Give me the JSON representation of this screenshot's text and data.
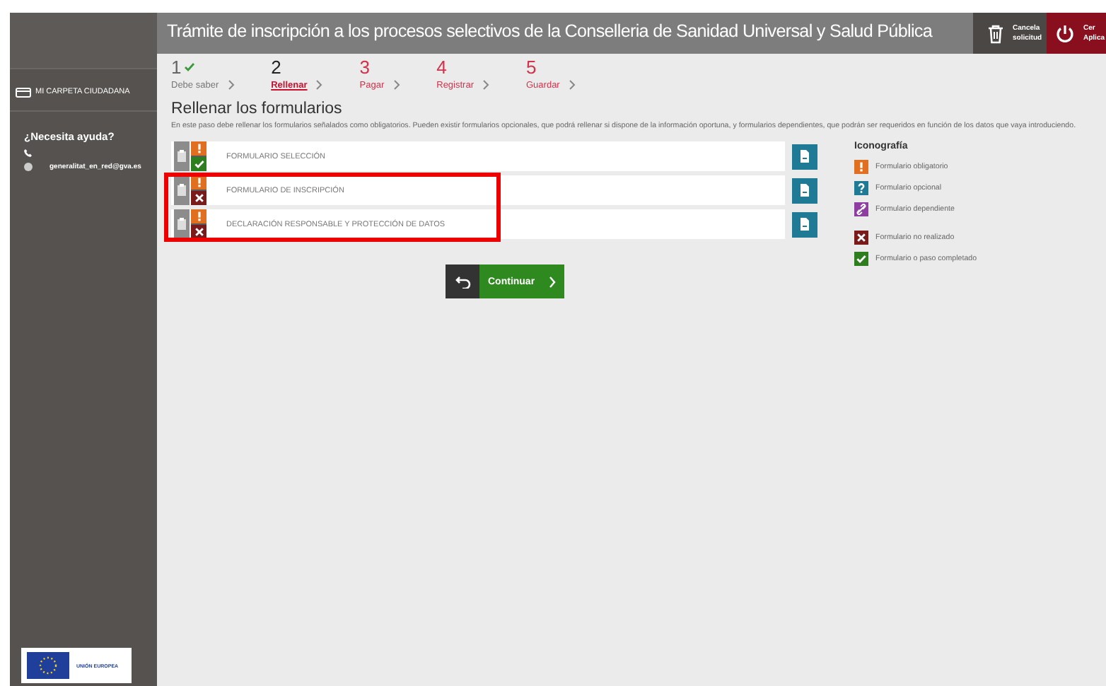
{
  "sidebar": {
    "folder_link": "MI CARPETA CIUDADANA",
    "help_title": "¿Necesita ayuda?",
    "email": "generalitat_en_red@gva.es",
    "footer_logo_text": "UNIÓN EUROPEA"
  },
  "header": {
    "title": "Trámite de inscripción a los procesos selectivos de la Conselleria de Sanidad Universal y Salud Pública",
    "buttons": [
      {
        "kind": "trash",
        "lines": [
          "Cancela",
          "solicitud"
        ]
      },
      {
        "kind": "power",
        "lines": [
          "Cer",
          "Aplica"
        ]
      }
    ]
  },
  "steps": [
    {
      "number": "1",
      "label": "Debe saber",
      "completed": true,
      "selected": false
    },
    {
      "number": "2",
      "label": "Rellenar",
      "completed": false,
      "selected": true
    },
    {
      "number": "3",
      "label": "Pagar",
      "completed": false,
      "selected": false
    },
    {
      "number": "4",
      "label": "Registrar",
      "completed": false,
      "selected": false
    },
    {
      "number": "5",
      "label": "Guardar",
      "completed": false,
      "selected": false
    }
  ],
  "heading": "Rellenar los formularios",
  "description": "En este paso debe rellenar los formularios señalados como obligatorios. Pueden existir formularios opcionales, que podrá rellenar si dispone de la información oportuna, y formularios dependientes, que podrán ser requeridos en función de los datos que vaya introduciendo.",
  "forms": [
    {
      "name": "FORMULARIO SELECCIÓN",
      "kind": "mandatory",
      "completed": true,
      "highlighted": false
    },
    {
      "name": "FORMULARIO DE INSCRIPCIÓN",
      "kind": "mandatory",
      "completed": false,
      "highlighted": true
    },
    {
      "name": "DECLARACIÓN RESPONSABLE Y PROTECCIÓN DE DATOS",
      "kind": "mandatory",
      "completed": false,
      "highlighted": true
    }
  ],
  "continue_button": {
    "label": "Continuar"
  },
  "legend": {
    "title": "Iconografía",
    "items": [
      {
        "kind": "mandatory",
        "label": "Formulario obligatorio"
      },
      {
        "kind": "optional",
        "label": "Formulario opcional"
      },
      {
        "kind": "dependent",
        "label": "Formulario dependiente"
      },
      {
        "kind": "not_done",
        "label": "Formulario no realizado"
      },
      {
        "kind": "done",
        "label": "Formulario o paso completado"
      }
    ]
  }
}
